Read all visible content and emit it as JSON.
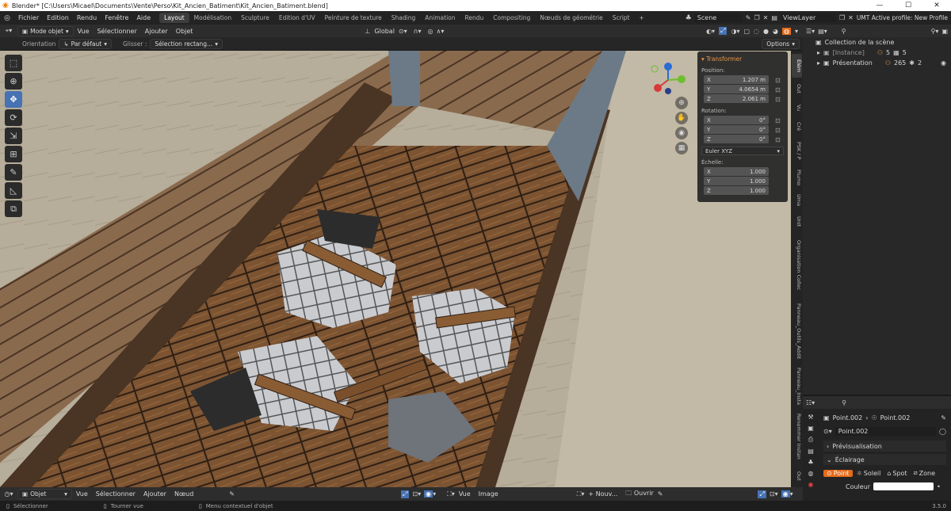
{
  "window": {
    "title": "Blender* [C:\\Users\\Micael\\Documents\\Vente\\Perso\\Kit_Ancien_Batiment\\Kit_Ancien_Batiment.blend]",
    "minimize": "—",
    "maximize": "☐",
    "close": "✕"
  },
  "menu": {
    "items": [
      "Fichier",
      "Edition",
      "Rendu",
      "Fenêtre",
      "Aide"
    ]
  },
  "workspaces": [
    "Layout",
    "Modélisation",
    "Sculpture",
    "Edition d'UV",
    "Peinture de texture",
    "Shading",
    "Animation",
    "Rendu",
    "Compositing",
    "Nœuds de géométrie",
    "Script"
  ],
  "workspace_add": "+",
  "scene": {
    "label": "Scene"
  },
  "viewlayer": {
    "label": "ViewLayer"
  },
  "profile": "UMT Active profile: New Profile",
  "header3d": {
    "mode": "Mode objet",
    "vue": "Vue",
    "selectionner": "Sélectionner",
    "ajouter": "Ajouter",
    "objet": "Objet",
    "transform": "Global"
  },
  "tool_options": {
    "orientation_label": "Orientation",
    "orientation_value": "Par défaut",
    "drag_label": "Glisser :",
    "drag_value": "Sélection rectang...",
    "options": "Options"
  },
  "npanel": {
    "title": "Transformer",
    "position_label": "Position:",
    "pos": [
      {
        "axis": "X",
        "value": "1.207 m"
      },
      {
        "axis": "Y",
        "value": "4.0654 m"
      },
      {
        "axis": "Z",
        "value": "2.061 m"
      }
    ],
    "rotation_label": "Rotation:",
    "rot": [
      {
        "axis": "X",
        "value": "0°"
      },
      {
        "axis": "Y",
        "value": "0°"
      },
      {
        "axis": "Z",
        "value": "0°"
      }
    ],
    "rotation_mode": "Euler XYZ",
    "scale_label": "Échelle:",
    "scale": [
      {
        "axis": "X",
        "value": "1.000"
      },
      {
        "axis": "Y",
        "value": "1.000"
      },
      {
        "axis": "Z",
        "value": "1.000"
      }
    ]
  },
  "vtabs": [
    "Élém",
    "Out",
    "Vu",
    "Cré",
    "PSK / P",
    "Plumo",
    "Uma",
    "Unit",
    "Organisation Collec",
    "Panneau_Outils_Addit",
    "Panneau_Insta",
    "Renommer Instan",
    "Out"
  ],
  "outliner": {
    "root": "Collection de la scène",
    "items": [
      {
        "label": "[Instance]",
        "c1": "5",
        "c2": "5"
      },
      {
        "label": "Présentation",
        "c1": "265",
        "c2": "2"
      }
    ]
  },
  "properties": {
    "breadcrumb_a": "Point.002",
    "breadcrumb_b": "Point.002",
    "data_name": "Point.002",
    "preview": "Prévisualisation",
    "lighting": "Éclairage",
    "light_types": [
      "Point",
      "Soleil",
      "Spot",
      "Zone"
    ],
    "color_label": "Couleur"
  },
  "bottom": {
    "mode": "Objet",
    "vue": "Vue",
    "selectionner": "Sélectionner",
    "ajouter": "Ajouter",
    "noeud": "Nœud",
    "vue2": "Vue",
    "image": "Image",
    "nouveau": "Nouv...",
    "ouvrir": "Ouvrir"
  },
  "status": {
    "left": "Sélectionner",
    "mid": "Tourner vue",
    "right": "Menu contextuel d'objet",
    "version": "3.5.0"
  },
  "colors": {
    "accent": "#4772b3",
    "orange": "#e59548",
    "light_active": "#e56a1a"
  }
}
